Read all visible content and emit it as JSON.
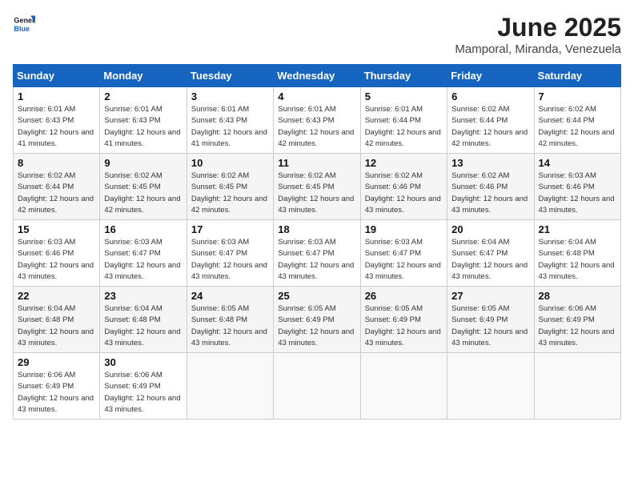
{
  "header": {
    "logo_general": "General",
    "logo_blue": "Blue",
    "month": "June 2025",
    "location": "Mamporal, Miranda, Venezuela"
  },
  "calendar": {
    "days_of_week": [
      "Sunday",
      "Monday",
      "Tuesday",
      "Wednesday",
      "Thursday",
      "Friday",
      "Saturday"
    ],
    "weeks": [
      [
        {
          "day": "1",
          "sunrise": "6:01 AM",
          "sunset": "6:43 PM",
          "daylight": "12 hours and 41 minutes."
        },
        {
          "day": "2",
          "sunrise": "6:01 AM",
          "sunset": "6:43 PM",
          "daylight": "12 hours and 41 minutes."
        },
        {
          "day": "3",
          "sunrise": "6:01 AM",
          "sunset": "6:43 PM",
          "daylight": "12 hours and 41 minutes."
        },
        {
          "day": "4",
          "sunrise": "6:01 AM",
          "sunset": "6:43 PM",
          "daylight": "12 hours and 42 minutes."
        },
        {
          "day": "5",
          "sunrise": "6:01 AM",
          "sunset": "6:44 PM",
          "daylight": "12 hours and 42 minutes."
        },
        {
          "day": "6",
          "sunrise": "6:02 AM",
          "sunset": "6:44 PM",
          "daylight": "12 hours and 42 minutes."
        },
        {
          "day": "7",
          "sunrise": "6:02 AM",
          "sunset": "6:44 PM",
          "daylight": "12 hours and 42 minutes."
        }
      ],
      [
        {
          "day": "8",
          "sunrise": "6:02 AM",
          "sunset": "6:44 PM",
          "daylight": "12 hours and 42 minutes."
        },
        {
          "day": "9",
          "sunrise": "6:02 AM",
          "sunset": "6:45 PM",
          "daylight": "12 hours and 42 minutes."
        },
        {
          "day": "10",
          "sunrise": "6:02 AM",
          "sunset": "6:45 PM",
          "daylight": "12 hours and 42 minutes."
        },
        {
          "day": "11",
          "sunrise": "6:02 AM",
          "sunset": "6:45 PM",
          "daylight": "12 hours and 43 minutes."
        },
        {
          "day": "12",
          "sunrise": "6:02 AM",
          "sunset": "6:46 PM",
          "daylight": "12 hours and 43 minutes."
        },
        {
          "day": "13",
          "sunrise": "6:02 AM",
          "sunset": "6:46 PM",
          "daylight": "12 hours and 43 minutes."
        },
        {
          "day": "14",
          "sunrise": "6:03 AM",
          "sunset": "6:46 PM",
          "daylight": "12 hours and 43 minutes."
        }
      ],
      [
        {
          "day": "15",
          "sunrise": "6:03 AM",
          "sunset": "6:46 PM",
          "daylight": "12 hours and 43 minutes."
        },
        {
          "day": "16",
          "sunrise": "6:03 AM",
          "sunset": "6:47 PM",
          "daylight": "12 hours and 43 minutes."
        },
        {
          "day": "17",
          "sunrise": "6:03 AM",
          "sunset": "6:47 PM",
          "daylight": "12 hours and 43 minutes."
        },
        {
          "day": "18",
          "sunrise": "6:03 AM",
          "sunset": "6:47 PM",
          "daylight": "12 hours and 43 minutes."
        },
        {
          "day": "19",
          "sunrise": "6:03 AM",
          "sunset": "6:47 PM",
          "daylight": "12 hours and 43 minutes."
        },
        {
          "day": "20",
          "sunrise": "6:04 AM",
          "sunset": "6:47 PM",
          "daylight": "12 hours and 43 minutes."
        },
        {
          "day": "21",
          "sunrise": "6:04 AM",
          "sunset": "6:48 PM",
          "daylight": "12 hours and 43 minutes."
        }
      ],
      [
        {
          "day": "22",
          "sunrise": "6:04 AM",
          "sunset": "6:48 PM",
          "daylight": "12 hours and 43 minutes."
        },
        {
          "day": "23",
          "sunrise": "6:04 AM",
          "sunset": "6:48 PM",
          "daylight": "12 hours and 43 minutes."
        },
        {
          "day": "24",
          "sunrise": "6:05 AM",
          "sunset": "6:48 PM",
          "daylight": "12 hours and 43 minutes."
        },
        {
          "day": "25",
          "sunrise": "6:05 AM",
          "sunset": "6:49 PM",
          "daylight": "12 hours and 43 minutes."
        },
        {
          "day": "26",
          "sunrise": "6:05 AM",
          "sunset": "6:49 PM",
          "daylight": "12 hours and 43 minutes."
        },
        {
          "day": "27",
          "sunrise": "6:05 AM",
          "sunset": "6:49 PM",
          "daylight": "12 hours and 43 minutes."
        },
        {
          "day": "28",
          "sunrise": "6:06 AM",
          "sunset": "6:49 PM",
          "daylight": "12 hours and 43 minutes."
        }
      ],
      [
        {
          "day": "29",
          "sunrise": "6:06 AM",
          "sunset": "6:49 PM",
          "daylight": "12 hours and 43 minutes."
        },
        {
          "day": "30",
          "sunrise": "6:06 AM",
          "sunset": "6:49 PM",
          "daylight": "12 hours and 43 minutes."
        },
        {
          "day": "",
          "sunrise": "",
          "sunset": "",
          "daylight": ""
        },
        {
          "day": "",
          "sunrise": "",
          "sunset": "",
          "daylight": ""
        },
        {
          "day": "",
          "sunrise": "",
          "sunset": "",
          "daylight": ""
        },
        {
          "day": "",
          "sunrise": "",
          "sunset": "",
          "daylight": ""
        },
        {
          "day": "",
          "sunrise": "",
          "sunset": "",
          "daylight": ""
        }
      ]
    ]
  },
  "labels": {
    "sunrise": "Sunrise:",
    "sunset": "Sunset:",
    "daylight": "Daylight:"
  }
}
